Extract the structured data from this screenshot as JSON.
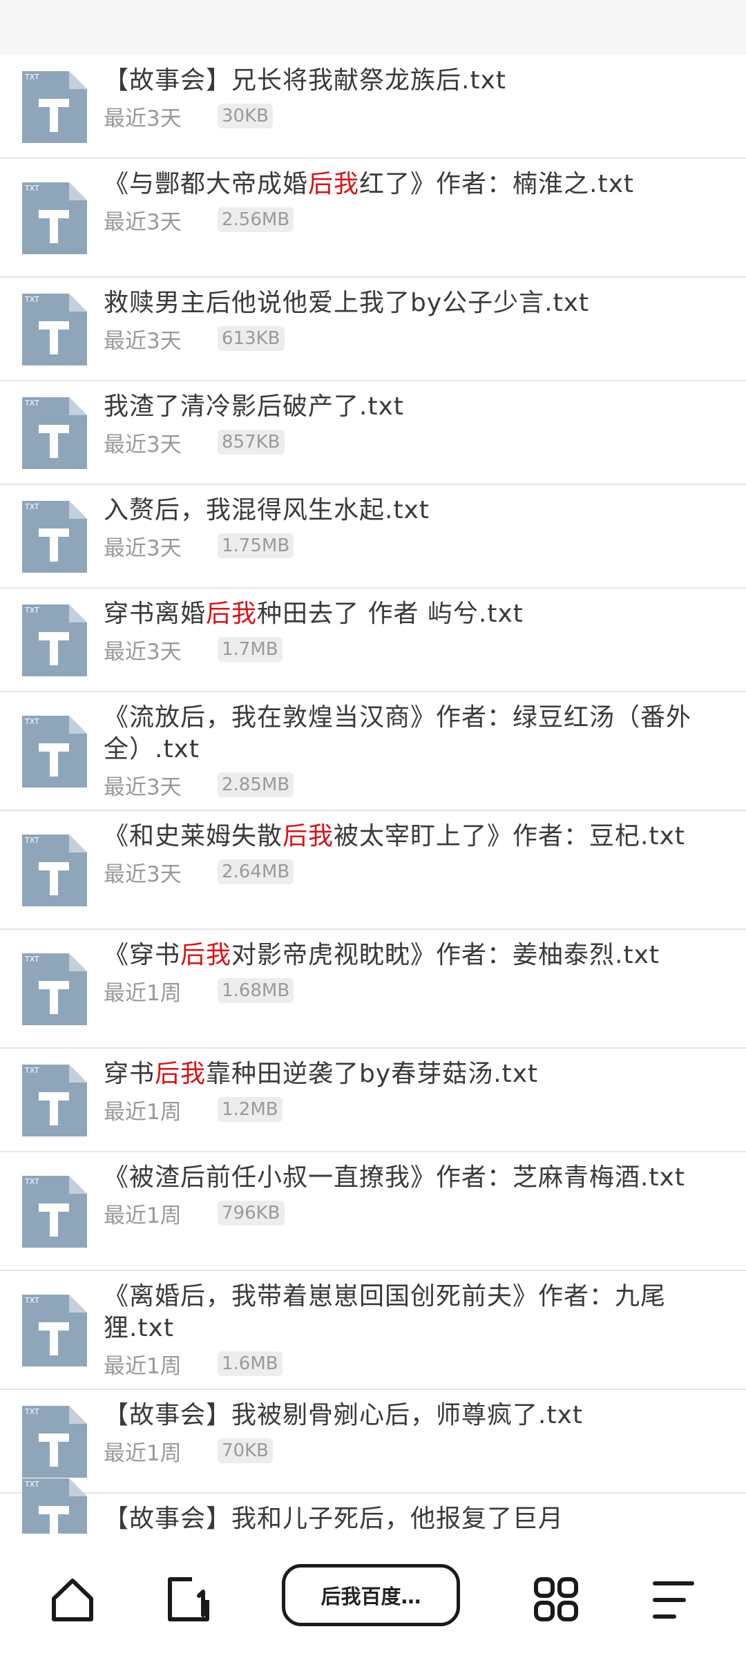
{
  "files": [
    {
      "title": [
        {
          "t": "【故事会】兄长将我献祭龙族后.txt"
        }
      ],
      "time": "最近3天",
      "size": "30KB"
    },
    {
      "title": [
        {
          "t": "《与酆都大帝成婚"
        },
        {
          "t": "后我",
          "hl": true
        },
        {
          "t": "红了》作者：楠淮之.txt"
        }
      ],
      "time": "最近3天",
      "size": "2.56MB"
    },
    {
      "title": [
        {
          "t": "救赎男主后他说他爱上我了by公子少言.txt"
        }
      ],
      "time": "最近3天",
      "size": "613KB"
    },
    {
      "title": [
        {
          "t": "我渣了清冷影后破产了.txt"
        }
      ],
      "time": "最近3天",
      "size": "857KB"
    },
    {
      "title": [
        {
          "t": "入赘后，我混得风生水起.txt"
        }
      ],
      "time": "最近3天",
      "size": "1.75MB"
    },
    {
      "title": [
        {
          "t": "穿书离婚"
        },
        {
          "t": "后我",
          "hl": true
        },
        {
          "t": "种田去了 作者 屿兮.txt"
        }
      ],
      "time": "最近3天",
      "size": "1.7MB"
    },
    {
      "title": [
        {
          "t": "《流放后，我在敦煌当汉商》作者：绿豆红汤（番外全）.txt"
        }
      ],
      "time": "最近3天",
      "size": "2.85MB"
    },
    {
      "title": [
        {
          "t": "《和史莱姆失散"
        },
        {
          "t": "后我",
          "hl": true
        },
        {
          "t": "被太宰盯上了》作者：豆杞.txt"
        }
      ],
      "time": "最近3天",
      "size": "2.64MB"
    },
    {
      "title": [
        {
          "t": "《穿书"
        },
        {
          "t": "后我",
          "hl": true
        },
        {
          "t": "对影帝虎视眈眈》作者：姜柚泰烈.txt"
        }
      ],
      "time": "最近1周",
      "size": "1.68MB"
    },
    {
      "title": [
        {
          "t": "穿书"
        },
        {
          "t": "后我",
          "hl": true
        },
        {
          "t": "靠种田逆袭了by春芽菇汤.txt"
        }
      ],
      "time": "最近1周",
      "size": "1.2MB"
    },
    {
      "title": [
        {
          "t": "《被渣后前任小叔一直撩我》作者：芝麻青梅酒.txt"
        }
      ],
      "time": "最近1周",
      "size": "796KB"
    },
    {
      "title": [
        {
          "t": "《离婚后，我带着崽崽回国创死前夫》作者：九尾狸.txt"
        }
      ],
      "time": "最近1周",
      "size": "1.6MB"
    },
    {
      "title": [
        {
          "t": "【故事会】我被剔骨剜心后，师尊疯了.txt"
        }
      ],
      "time": "最近1周",
      "size": "70KB"
    },
    {
      "title": [
        {
          "t": "【故事会】我和儿子死后，他报复了巨月"
        }
      ],
      "time": "",
      "size": ""
    }
  ],
  "icon_label": "TXT",
  "icon_names": {
    "file": "txt-file-icon",
    "home": "home-icon",
    "tab": "tab-icon",
    "apps": "apps-grid-icon",
    "menu": "menu-icon"
  },
  "bottom_bar": {
    "search_label": "后我百度…"
  },
  "colors": {
    "highlight": "#d7141a",
    "icon": "#8fa5b9",
    "divider": "#e6e6e6"
  }
}
